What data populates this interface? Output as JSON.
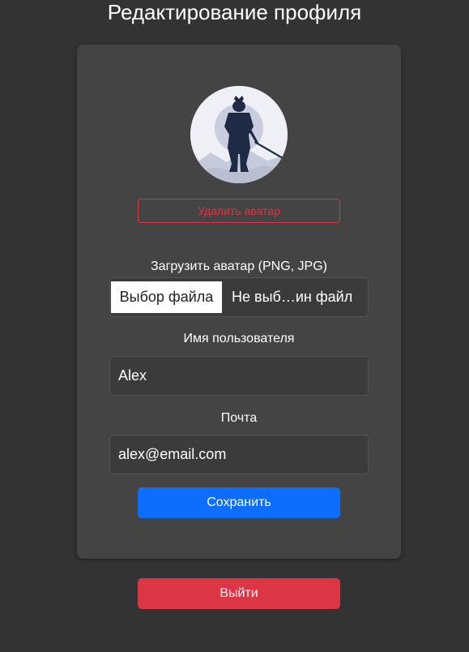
{
  "page": {
    "title": "Редактирование профиля"
  },
  "profile_form": {
    "avatar_icon": "samurai-silhouette",
    "delete_avatar_label": "Удалить аватар",
    "upload_label": "Загрузить аватар (PNG, JPG)",
    "file_button_label": "Выбор файла",
    "file_status_text": "Не выб…ин файл",
    "username_label": "Имя пользователя",
    "username_value": "Alex",
    "email_label": "Почта",
    "email_value": "alex@email.com",
    "save_label": "Сохранить"
  },
  "logout_label": "Выйти",
  "colors": {
    "background": "#333333",
    "card": "#444444",
    "primary": "#0d6efd",
    "danger": "#dc3545"
  }
}
